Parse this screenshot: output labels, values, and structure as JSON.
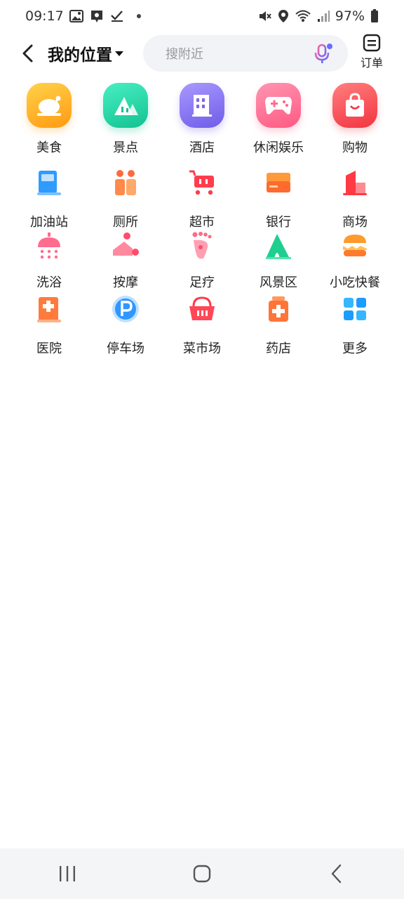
{
  "status_bar": {
    "time": "09:17",
    "battery": "97%"
  },
  "header": {
    "location": "我的位置",
    "search_placeholder": "搜附近",
    "order_label": "订单"
  },
  "top_categories": [
    {
      "label": "美食",
      "icon": "food-icon",
      "color": "#ffb21e"
    },
    {
      "label": "景点",
      "icon": "scenic-icon",
      "color": "#27d4a4"
    },
    {
      "label": "酒店",
      "icon": "hotel-icon",
      "color": "#8d78f4"
    },
    {
      "label": "休闲娱乐",
      "icon": "game-icon",
      "color": "#ff6d91"
    },
    {
      "label": "购物",
      "icon": "shopping-bag-icon",
      "color": "#ff4f5a"
    }
  ],
  "categories": [
    {
      "label": "加油站",
      "icon": "gas-station-icon"
    },
    {
      "label": "厕所",
      "icon": "toilet-icon"
    },
    {
      "label": "超市",
      "icon": "supermarket-cart-icon"
    },
    {
      "label": "银行",
      "icon": "bank-card-icon"
    },
    {
      "label": "商场",
      "icon": "mall-icon"
    },
    {
      "label": "洗浴",
      "icon": "shower-icon"
    },
    {
      "label": "按摩",
      "icon": "massage-icon"
    },
    {
      "label": "足疗",
      "icon": "foot-icon"
    },
    {
      "label": "风景区",
      "icon": "mountain-icon"
    },
    {
      "label": "小吃快餐",
      "icon": "burger-icon"
    },
    {
      "label": "医院",
      "icon": "hospital-icon"
    },
    {
      "label": "停车场",
      "icon": "parking-icon"
    },
    {
      "label": "菜市场",
      "icon": "basket-icon"
    },
    {
      "label": "药店",
      "icon": "pharmacy-icon"
    },
    {
      "label": "更多",
      "icon": "more-grid-icon"
    }
  ]
}
